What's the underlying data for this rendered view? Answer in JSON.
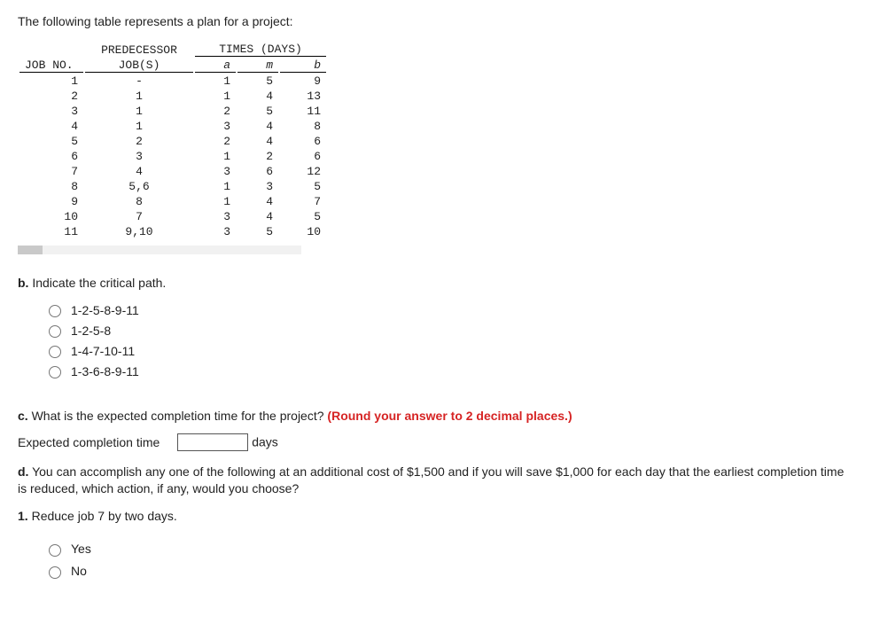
{
  "intro": "The following table represents a plan for a project:",
  "table": {
    "header": {
      "jobno": "JOB NO.",
      "pred": "PREDECESSOR",
      "jobs": "JOB(S)",
      "times": "TIMES (DAYS)",
      "a": "a",
      "m": "m",
      "b": "b"
    },
    "rows": [
      {
        "job": "1",
        "pred": "-",
        "a": "1",
        "m": "5",
        "b": "9"
      },
      {
        "job": "2",
        "pred": "1",
        "a": "1",
        "m": "4",
        "b": "13"
      },
      {
        "job": "3",
        "pred": "1",
        "a": "2",
        "m": "5",
        "b": "11"
      },
      {
        "job": "4",
        "pred": "1",
        "a": "3",
        "m": "4",
        "b": "8"
      },
      {
        "job": "5",
        "pred": "2",
        "a": "2",
        "m": "4",
        "b": "6"
      },
      {
        "job": "6",
        "pred": "3",
        "a": "1",
        "m": "2",
        "b": "6"
      },
      {
        "job": "7",
        "pred": "4",
        "a": "3",
        "m": "6",
        "b": "12"
      },
      {
        "job": "8",
        "pred": "5,6",
        "a": "1",
        "m": "3",
        "b": "5"
      },
      {
        "job": "9",
        "pred": "8",
        "a": "1",
        "m": "4",
        "b": "7"
      },
      {
        "job": "10",
        "pred": "7",
        "a": "3",
        "m": "4",
        "b": "5"
      },
      {
        "job": "11",
        "pred": "9,10",
        "a": "3",
        "m": "5",
        "b": "10"
      }
    ]
  },
  "partB": {
    "label_b": "b.",
    "label_text": " Indicate the critical path.",
    "options": [
      "1-2-5-8-9-11",
      "1-2-5-8",
      "1-4-7-10-11",
      "1-3-6-8-9-11"
    ]
  },
  "partC": {
    "label_c": "c.",
    "label_text": " What is the expected completion time for the project? ",
    "note": "(Round your answer to 2 decimal places.)",
    "row_label": "Expected completion time",
    "unit": "days"
  },
  "partD": {
    "label_d": "d.",
    "label_text": " You can accomplish any one of the following at an additional cost of $1,500 and if you will save $1,000 for each day that the earliest completion time is reduced, which action, if any, would you choose?",
    "sub_b": "1.",
    "sub_text": " Reduce job 7 by two days.",
    "yes": "Yes",
    "no": "No"
  }
}
